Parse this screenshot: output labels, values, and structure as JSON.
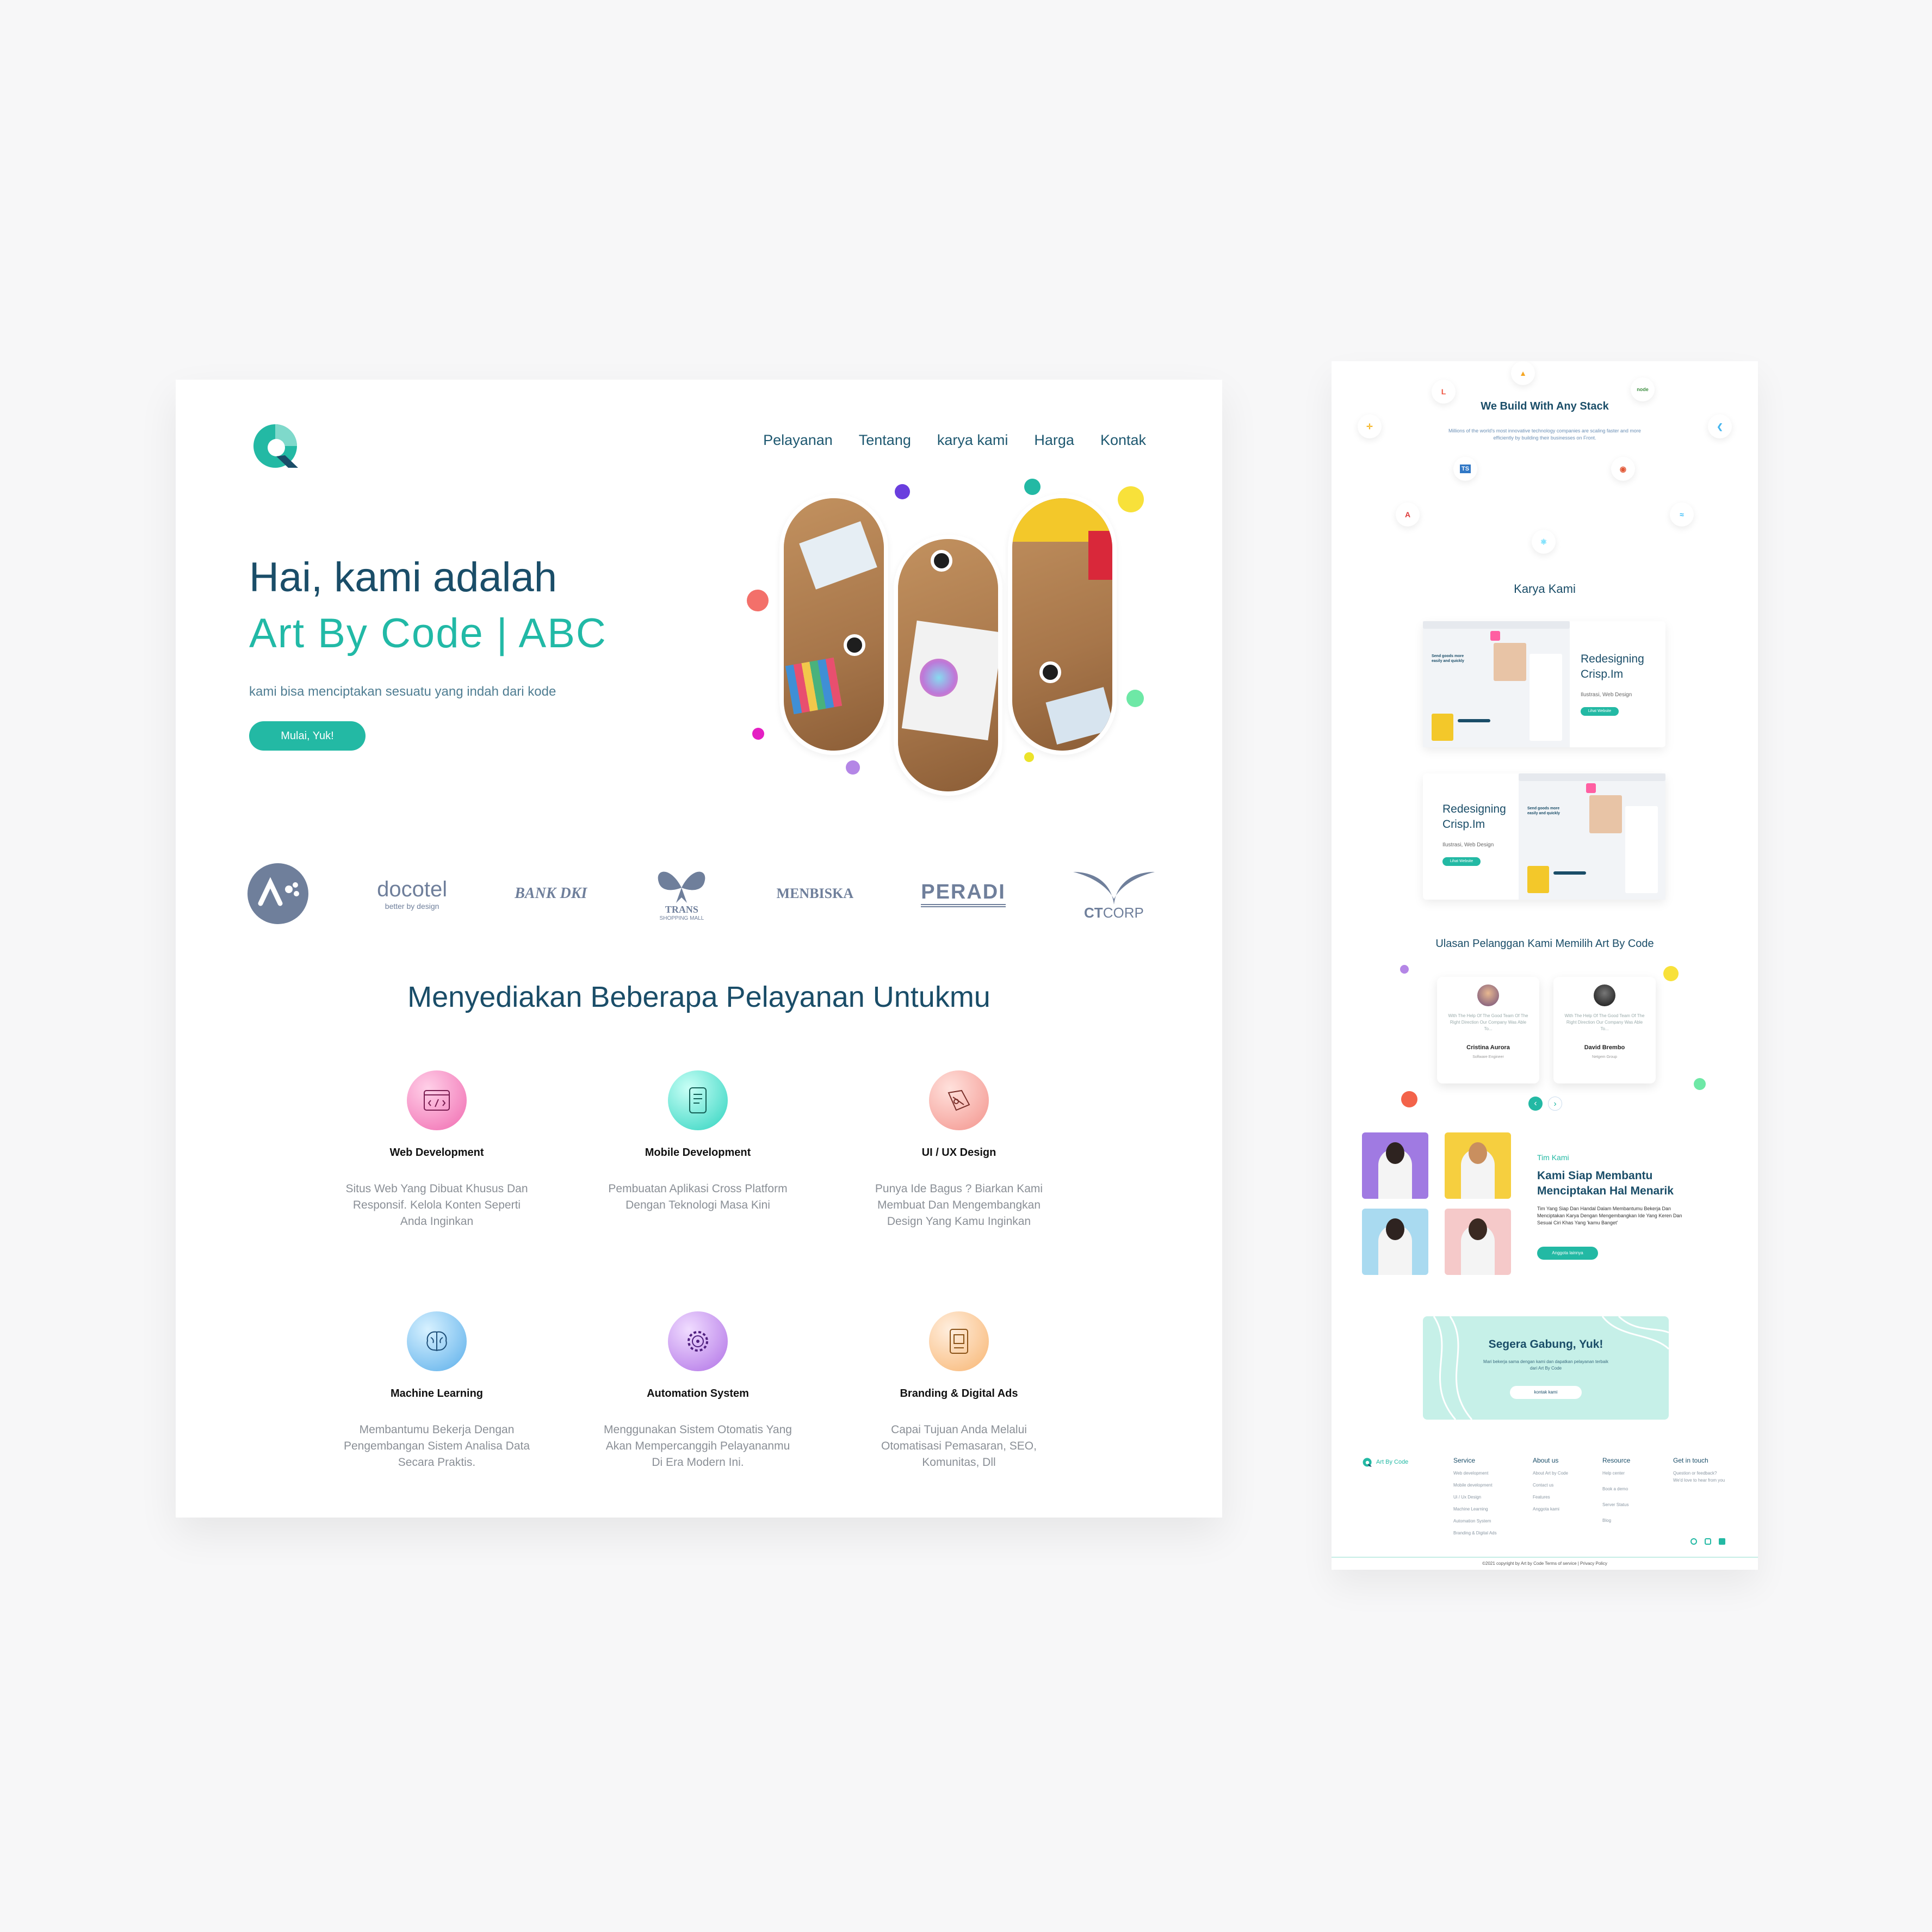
{
  "landing": {
    "nav": [
      "Pelayanan",
      "Tentang",
      "karya kami",
      "Harga",
      "Kontak"
    ],
    "hero": {
      "line1": "Hai, kami adalah",
      "line2": "Art By Code | ABC",
      "subtitle": "kami bisa menciptakan sesuatu yang indah dari kode",
      "cta": "Mulai, Yuk!"
    },
    "partners": [
      "docotel",
      "better by design",
      "BANK DKI",
      "TRANS",
      "SHOPPING MALL",
      "MENBISKA",
      "PERADI",
      "CT",
      "CORP"
    ],
    "services_title": "Menyediakan Beberapa Pelayanan Untukmu",
    "services": [
      {
        "title": "Web Development",
        "desc": "Situs Web Yang Dibuat Khusus Dan Responsif. Kelola Konten Seperti Anda Inginkan",
        "icon": "code-window-icon",
        "color": "#f06ab0"
      },
      {
        "title": "Mobile Development",
        "desc": "Pembuatan Aplikasi Cross Platform Dengan Teknologi Masa Kini",
        "icon": "mobile-icon",
        "color": "#2ed3bf"
      },
      {
        "title": "UI / UX Design",
        "desc": "Punya Ide Bagus ? Biarkan Kami Membuat Dan Mengembangkan Design Yang Kamu Inginkan",
        "icon": "design-icon",
        "color": "#f3938c"
      },
      {
        "title": "Machine Learning",
        "desc": "Membantumu Bekerja Dengan Pengembangan Sistem Analisa Data Secara Praktis.",
        "icon": "brain-icon",
        "color": "#5aaeea"
      },
      {
        "title": "Automation System",
        "desc": "Menggunakan Sistem Otomatis Yang Akan Mempercanggih Pelayananmu Di Era Modern Ini.",
        "icon": "gear-icon",
        "color": "#b071e6"
      },
      {
        "title": "Branding & Digital Ads",
        "desc": "Capai Tujuan Anda Melalui Otomatisasi Pemasaran, SEO, Komunitas, Dll",
        "icon": "ads-icon",
        "color": "#f8b571"
      }
    ]
  },
  "preview": {
    "stack_title": "We Build With Any Stack",
    "stack_subtitle": "Millions of the world's most innovative technology companies are scaling faster and more efficiently by building their businesses on Front.",
    "stack_icons": [
      "node",
      "TS"
    ],
    "karya_title": "Karya Kami",
    "works": [
      {
        "title": "Redesigning Crisp.Im",
        "tags": "Ilustrasi, Web Design",
        "btn": "Lihat Website"
      },
      {
        "title": "Redesigning Crisp.Im",
        "tags": "Ilustrasi, Web Design",
        "btn": "Lihat Website"
      }
    ],
    "mock_headline": "Send goods more easily and quickly",
    "review_title": "Ulasan Pelanggan Kami Memilih Art By Code",
    "reviews": [
      {
        "text": "With The Help Of The Good Team Of The Right Direction Our Company Was Able To...",
        "name": "Cristina Aurora",
        "role": "Software Engineer"
      },
      {
        "text": "With The Help Of The Good Team Of The Right Direction Our Company Was Able To...",
        "name": "David Brembo",
        "role": "Netgem Group"
      }
    ],
    "team": {
      "label": "Tim Kami",
      "heading": "Kami Siap Membantu Menciptakan Hal Menarik",
      "desc": "Tim Yang Siap Dan Handal Dalam Membantumu Bekerja Dan Menciptakan Karya Dengan Mengembangkan Ide Yang Keren Dan Sesuai Ciri Khas Yang 'kamu Banget'",
      "btn": "Anggota lainnya"
    },
    "join": {
      "title": "Segera Gabung, Yuk!",
      "text": "Mari bekerja sama dengan kami dan dapatkan pelayanan terbaik dari Art By Code",
      "btn": "kontak kami"
    },
    "footer": {
      "brand": "Art By Code",
      "columns": [
        {
          "head": "Service",
          "links": [
            "Web development",
            "Mobile development",
            "Ui / Ux Design",
            "Machine Learning",
            "Automation System",
            "Branding & Digital Ads"
          ]
        },
        {
          "head": "About us",
          "links": [
            "About Art by Code",
            "Contact us",
            "Features",
            "Anggota kami"
          ]
        },
        {
          "head": "Resource",
          "links": [
            "Help center",
            "Book a demo",
            "Server Status",
            "Blog"
          ]
        },
        {
          "head": "Get in touch",
          "links": [
            "Question or feedback?",
            "We'd love to hear from you"
          ]
        }
      ],
      "copyright": "©2021 copyright by Art by Code Terms of service | Privacy Policy"
    }
  },
  "colors": {
    "teal": "#23b9a4",
    "navy": "#1a4d68"
  }
}
